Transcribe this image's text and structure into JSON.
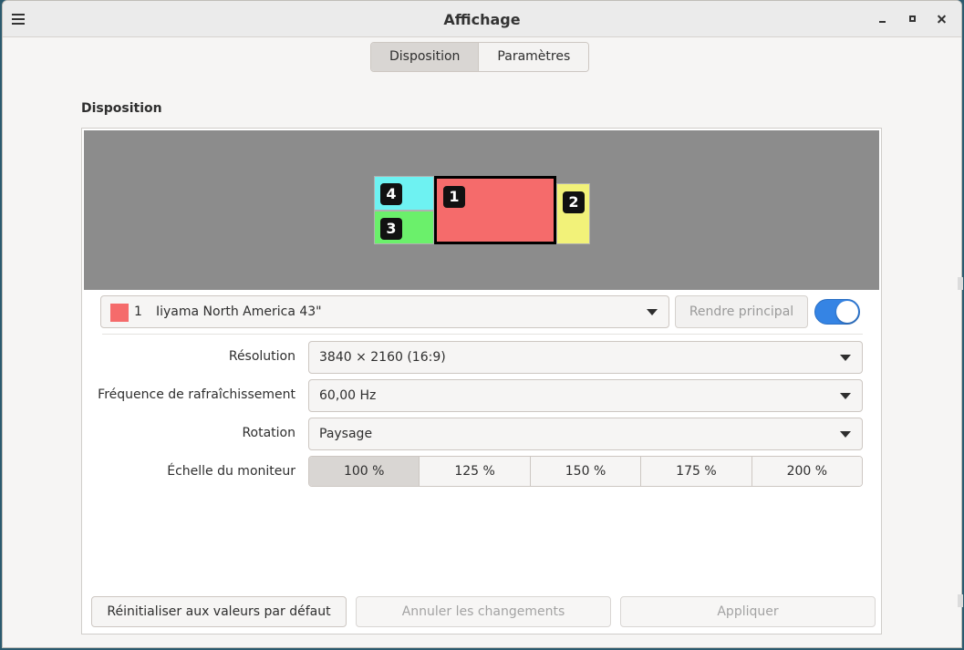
{
  "window": {
    "title": "Affichage"
  },
  "tabs": [
    {
      "label": "Disposition",
      "active": true
    },
    {
      "label": "Paramètres",
      "active": false
    }
  ],
  "section": {
    "title": "Disposition"
  },
  "monitors": [
    {
      "number": "1",
      "color": "#f56b6b",
      "selected": true
    },
    {
      "number": "2",
      "color": "#f2f279"
    },
    {
      "number": "3",
      "color": "#6bf06b"
    },
    {
      "number": "4",
      "color": "#6ef2f2"
    }
  ],
  "selected_monitor": {
    "number": "1",
    "name": "Iiyama North America 43\"",
    "color": "#f56b6b",
    "make_primary_label": "Rendre principal",
    "enabled": true
  },
  "settings": {
    "resolution": {
      "label": "Résolution",
      "value": "3840 × 2160 (16:9)"
    },
    "refresh": {
      "label": "Fréquence de rafraîchissement",
      "value": "60,00 Hz"
    },
    "rotation": {
      "label": "Rotation",
      "value": "Paysage"
    },
    "scale": {
      "label": "Échelle du moniteur",
      "options": [
        "100 %",
        "125 %",
        "150 %",
        "175 %",
        "200 %"
      ],
      "selected": "100 %"
    }
  },
  "actions": {
    "reset": "Réinitialiser aux valeurs par défaut",
    "cancel": "Annuler les changements",
    "apply": "Appliquer"
  },
  "colors": {
    "accent": "#3584e4",
    "canvas": "#8c8c8c"
  }
}
